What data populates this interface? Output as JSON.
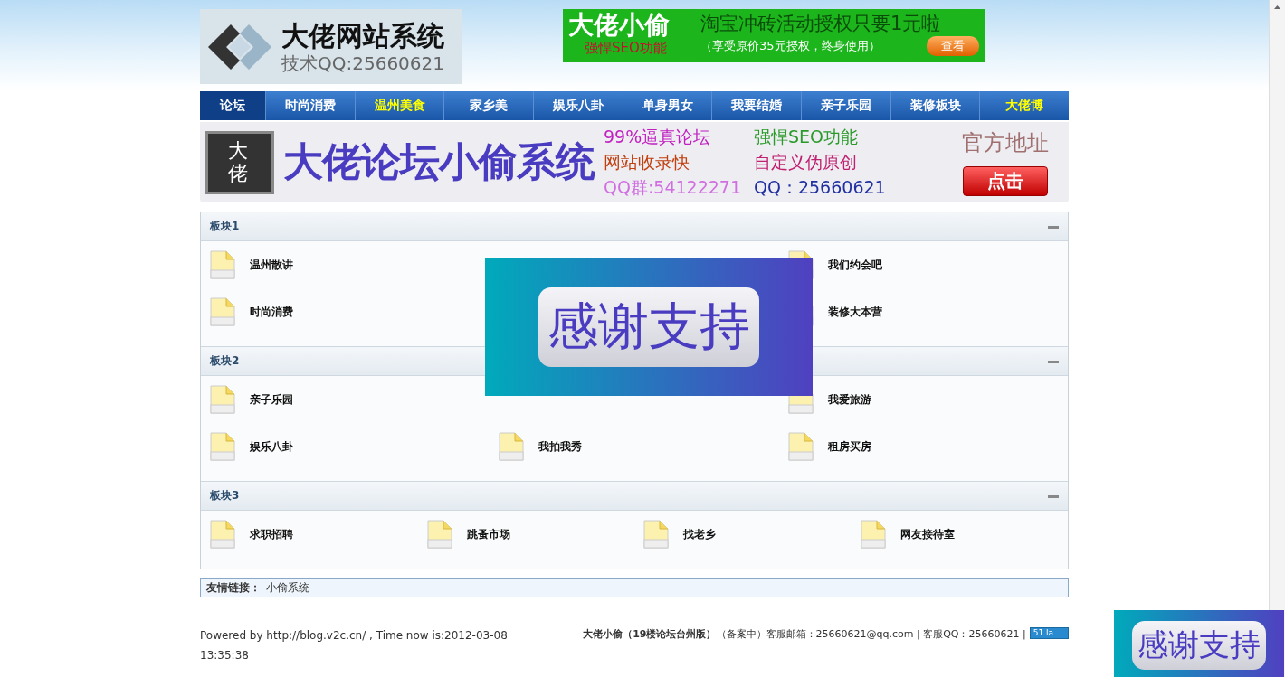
{
  "logo": {
    "title": "大佬网站系统",
    "subtitle": "技术QQ:25660621"
  },
  "top_ad": {
    "brand": "大佬小偷",
    "headline": "淘宝冲砖活动授权只要1元啦",
    "tagline": "强悍SEO功能",
    "note": "（享受原价35元授权，终身使用）",
    "button": "查看"
  },
  "nav": [
    {
      "label": "论坛",
      "selected": true,
      "highlight": false
    },
    {
      "label": "时尚消费",
      "selected": false,
      "highlight": false
    },
    {
      "label": "温州美食",
      "selected": false,
      "highlight": true
    },
    {
      "label": "家乡美",
      "selected": false,
      "highlight": false
    },
    {
      "label": "娱乐八卦",
      "selected": false,
      "highlight": false
    },
    {
      "label": "单身男女",
      "selected": false,
      "highlight": false
    },
    {
      "label": "我要结婚",
      "selected": false,
      "highlight": false
    },
    {
      "label": "亲子乐园",
      "selected": false,
      "highlight": false
    },
    {
      "label": "装修板块",
      "selected": false,
      "highlight": false
    },
    {
      "label": "大佬博",
      "selected": false,
      "highlight": true
    }
  ],
  "banner": {
    "seal": "大佬",
    "title": "大佬论坛小偷系统",
    "features": [
      "99%逼真论坛",
      "强悍SEO功能",
      "网站收录快",
      "自定义伪原创"
    ],
    "qq_group": "QQ群:54122271",
    "qq": "QQ：25660621",
    "official": "官方地址",
    "button": "点击"
  },
  "sections": [
    {
      "title": "板块1",
      "expanded": true,
      "rows": [
        [
          {
            "label": "温州散讲"
          },
          null,
          {
            "label": "我们约会吧"
          }
        ],
        [
          {
            "label": "时尚消费"
          },
          null,
          {
            "label": "装修大本营"
          }
        ]
      ]
    },
    {
      "title": "板块2",
      "expanded": true,
      "rows": [
        [
          {
            "label": "亲子乐园"
          },
          null,
          {
            "label": "我爱旅游"
          }
        ],
        [
          {
            "label": "娱乐八卦"
          },
          {
            "label": "我拍我秀"
          },
          {
            "label": "租房买房"
          }
        ]
      ]
    },
    {
      "title": "板块3",
      "expanded": true,
      "rows": [
        [
          {
            "label": "求职招聘"
          },
          {
            "label": "跳蚤市场"
          },
          {
            "label": "找老乡"
          },
          {
            "label": "网友接待室"
          }
        ]
      ]
    }
  ],
  "links": {
    "label": "友情链接：",
    "items": [
      "小偷系统"
    ]
  },
  "footer": {
    "powered": "Powered by http://blog.v2c.cn/ , Time now is:2012-03-08 13:35:38",
    "info": "**大佬小偷（19楼论坛台州版）**（备案中）客服邮箱：25660621@qq.com | 客服QQ：25660621 |",
    "badge": "51.la"
  },
  "popups": [
    {
      "text": "感谢支持"
    },
    {
      "text": "感谢支持"
    }
  ]
}
